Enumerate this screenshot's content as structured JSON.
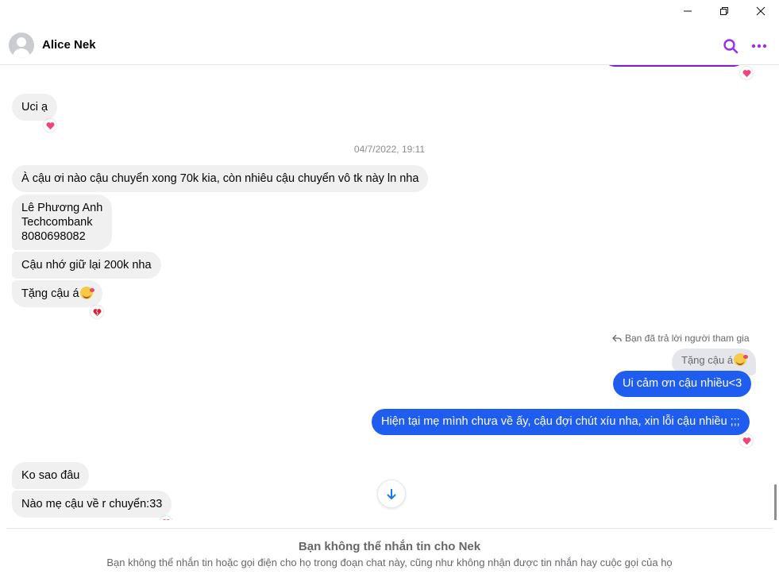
{
  "window": {
    "minimize_icon": "minimize-icon",
    "restore_icon": "restore-icon",
    "close_icon": "close-icon"
  },
  "header": {
    "contact_name": "Alice Nek",
    "search_icon": "search-icon",
    "more_icon": "more-options-icon",
    "accent_color": "#9b2cf0"
  },
  "messages": [
    {
      "type": "incoming",
      "text": "Uci ạ",
      "reaction": "heart"
    },
    {
      "type": "timestamp",
      "text": "04/7/2022, 19:11"
    },
    {
      "type": "incoming",
      "text": "À cậu ơi nào cậu chuyển xong 70k kia, còn nhiêu cậu chuyển vô tk này ln nha"
    },
    {
      "type": "incoming",
      "lines": [
        "Lê Phương Anh",
        "Techcombank",
        "8080698082"
      ]
    },
    {
      "type": "incoming",
      "text": "Cậu nhớ giữ lại 200k nha"
    },
    {
      "type": "incoming",
      "text": "Tặng cậu á",
      "emoji": "smiling-face-with-hearts",
      "reaction": "broken-heart"
    },
    {
      "type": "reply_note",
      "text": "Bạn đã trả lời người tham gia"
    },
    {
      "type": "reply_quote",
      "text": "Tặng cậu á",
      "emoji": "smiling-face-with-hearts"
    },
    {
      "type": "outgoing",
      "text": "Ui cảm ơn cậu nhiều<3"
    },
    {
      "type": "outgoing",
      "text": "Hiện tại mẹ mình chưa về ấy, cậu đợi chút xíu nha, xin lỗi cậu nhiều ;;;",
      "reaction": "heart"
    },
    {
      "type": "incoming",
      "text": "Ko sao đâu"
    },
    {
      "type": "incoming",
      "text": "Nào mẹ cậu về r chuyển:33",
      "reaction": "heart"
    }
  ],
  "colors": {
    "outgoing_bubble": "#1f5df0",
    "incoming_bubble": "#f0f0f0",
    "heart": "#f0447a"
  },
  "footer": {
    "title": "Bạn không thể nhắn tin cho Nek",
    "subtitle": "Bạn không thể nhắn tin hoặc gọi điện cho họ trong đoạn chat này, cũng như không nhận được tin nhắn hay cuộc gọi của họ"
  }
}
